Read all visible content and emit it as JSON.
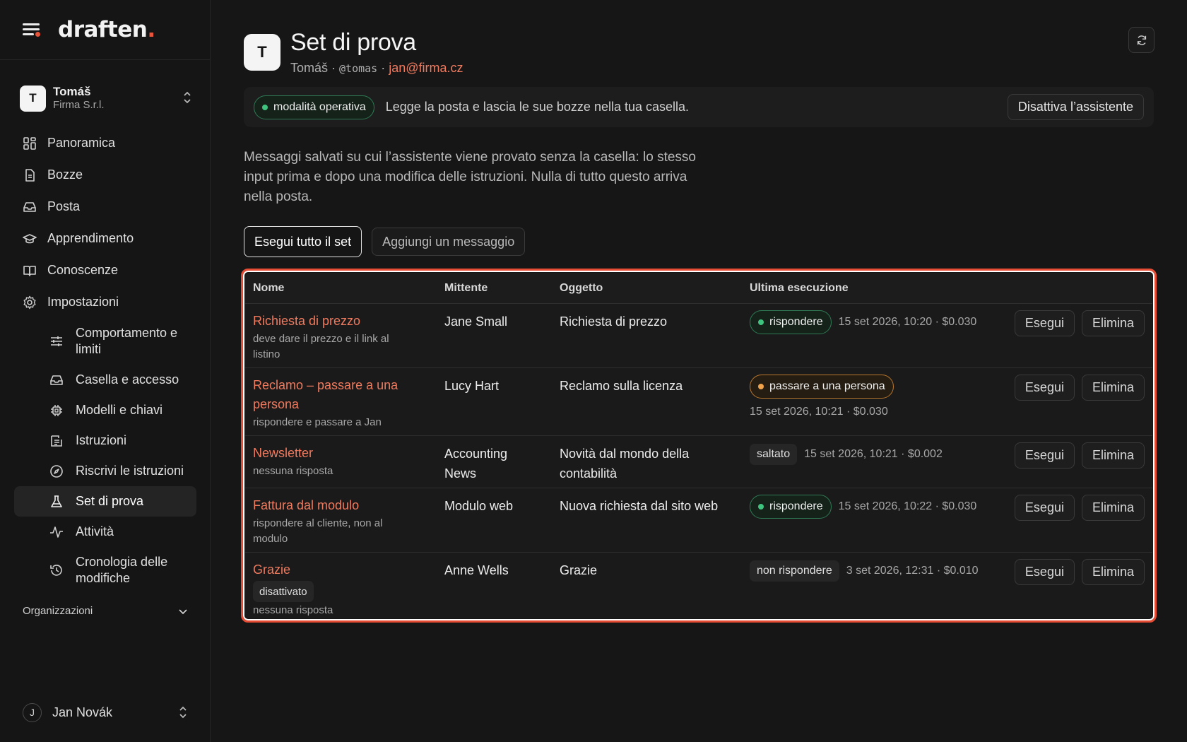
{
  "app": {
    "logo_text": "draften",
    "logo_dot": "."
  },
  "account": {
    "initial": "T",
    "name": "Tomáš",
    "org": "Firma S.r.l."
  },
  "nav": [
    {
      "label": "Panoramica",
      "icon": "grid-icon"
    },
    {
      "label": "Bozze",
      "icon": "document-icon"
    },
    {
      "label": "Posta",
      "icon": "inbox-icon"
    },
    {
      "label": "Apprendimento",
      "icon": "graduation-cap-icon"
    },
    {
      "label": "Conoscenze",
      "icon": "book-icon"
    },
    {
      "label": "Impostazioni",
      "icon": "gear-icon"
    }
  ],
  "settings_sub": [
    {
      "label": "Comportamento e limiti",
      "icon": "sliders-icon"
    },
    {
      "label": "Casella e accesso",
      "icon": "inbox-icon"
    },
    {
      "label": "Modelli e chiavi",
      "icon": "chip-icon"
    },
    {
      "label": "Istruzioni",
      "icon": "list-icon"
    },
    {
      "label": "Riscrivi le istruzioni",
      "icon": "compass-icon"
    },
    {
      "label": "Set di prova",
      "icon": "flask-icon",
      "active": true
    },
    {
      "label": "Attività",
      "icon": "activity-icon"
    },
    {
      "label": "Cronologia delle modifiche",
      "icon": "history-icon"
    }
  ],
  "organizations_label": "Organizzazioni",
  "user": {
    "initial": "J",
    "name": "Jan Novák"
  },
  "header": {
    "avatar_initial": "T",
    "title": "Set di prova",
    "name": "Tomáš",
    "sep1": " · ",
    "handle": "@tomas",
    "sep2": " · ",
    "email": "jan@firma.cz"
  },
  "banner": {
    "mode_label": "modalità operativa",
    "text": "Legge la posta e lascia le sue bozze nella tua casella.",
    "button": "Disattiva l’assistente"
  },
  "description": "Messaggi salvati su cui l’assistente viene provato senza la casella: lo stesso input prima e dopo una modifica delle istruzioni. Nulla di tutto questo arriva nella posta.",
  "actions": {
    "run_all": "Esegui tutto il set",
    "add_message": "Aggiungi un messaggio"
  },
  "table": {
    "headers": {
      "name": "Nome",
      "sender": "Mittente",
      "subject": "Oggetto",
      "last_run": "Ultima esecuzione"
    },
    "run_label": "Esegui",
    "delete_label": "Elimina",
    "rows": [
      {
        "title": "Richiesta di prezzo",
        "note": "deve dare il prezzo e il link al listino",
        "sender": "Jane Small",
        "subject": "Richiesta di prezzo",
        "status": "rispondere",
        "status_kind": "green",
        "meta": "15 set 2026, 10:20 · $0.030"
      },
      {
        "title": "Reclamo – passare a una persona",
        "note": "rispondere e passare a Jan",
        "sender": "Lucy Hart",
        "subject": "Reclamo sulla licenza",
        "status": "passare a una persona",
        "status_kind": "orange",
        "meta": "15 set 2026, 10:21 · $0.030"
      },
      {
        "title": "Newsletter",
        "note": "nessuna risposta",
        "sender": "Accounting News",
        "subject": "Novità dal mondo della contabilità",
        "status": "saltato",
        "status_kind": "gray",
        "meta": "15 set 2026, 10:21 · $0.002"
      },
      {
        "title": "Fattura dal modulo",
        "note": "rispondere al cliente, non al modulo",
        "sender": "Modulo web",
        "subject": "Nuova richiesta dal sito web",
        "status": "rispondere",
        "status_kind": "green",
        "meta": "15 set 2026, 10:22 · $0.030"
      },
      {
        "title": "Grazie",
        "tag": "disattivato",
        "note": "nessuna risposta",
        "sender": "Anne Wells",
        "subject": "Grazie",
        "status": "non rispondere",
        "status_kind": "gray",
        "meta": "3 set 2026, 12:31 · $0.010"
      }
    ]
  },
  "colors": {
    "accent": "#e8553a",
    "link": "#f07a5e",
    "status_green": "#3ec47e",
    "status_orange": "#f0a34a"
  }
}
